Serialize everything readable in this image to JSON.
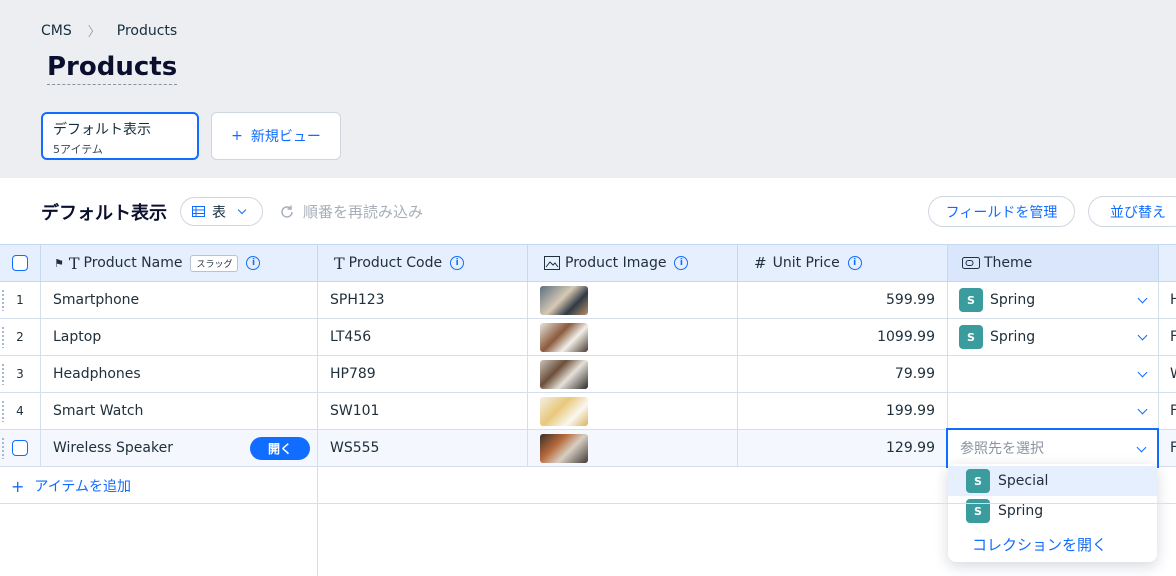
{
  "breadcrumb": {
    "root": "CMS",
    "current": "Products"
  },
  "page_title": "Products",
  "view_card": {
    "title": "デフォルト表示",
    "count": "5アイテム"
  },
  "new_view_label": "新規ビュー",
  "toolbar": {
    "title": "デフォルト表示",
    "view_type": "表",
    "reload": "順番を再読み込み",
    "manage_fields": "フィールドを管理",
    "sort": "並び替え"
  },
  "columns": {
    "name": "Product Name",
    "slug_badge": "スラッグ",
    "code": "Product Code",
    "image": "Product Image",
    "price": "Unit Price",
    "theme": "Theme"
  },
  "rows": [
    {
      "num": "1",
      "name": "Smartphone",
      "code": "SPH123",
      "price": "599.99",
      "theme": "Spring",
      "theme_initial": "S",
      "extra": "H"
    },
    {
      "num": "2",
      "name": "Laptop",
      "code": "LT456",
      "price": "1099.99",
      "theme": "Spring",
      "theme_initial": "S",
      "extra": "F"
    },
    {
      "num": "3",
      "name": "Headphones",
      "code": "HP789",
      "price": "79.99",
      "theme": "",
      "theme_initial": "",
      "extra": "W"
    },
    {
      "num": "4",
      "name": "Smart Watch",
      "code": "SW101",
      "price": "199.99",
      "theme": "",
      "theme_initial": "",
      "extra": "F"
    },
    {
      "num": "",
      "name": "Wireless Speaker",
      "code": "WS555",
      "price": "129.99",
      "theme": "",
      "theme_initial": "",
      "extra": "F"
    }
  ],
  "open_label": "開く",
  "theme_placeholder": "参照先を選択",
  "dropdown": {
    "options": [
      {
        "initial": "S",
        "label": "Special"
      },
      {
        "initial": "S",
        "label": "Spring"
      }
    ],
    "open_collection": "コレクションを開く"
  },
  "add_item_label": "アイテムを追加",
  "colors": {
    "accent": "#116dff",
    "chip": "#3a9c9c",
    "header_bg": "#eceef2"
  }
}
